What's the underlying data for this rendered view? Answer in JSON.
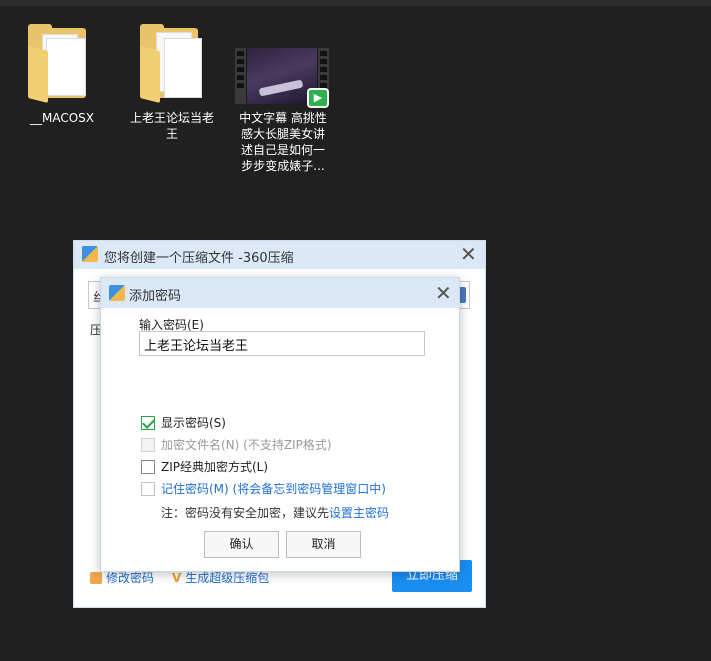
{
  "desktop": {
    "items": [
      {
        "label": "__MACOSX"
      },
      {
        "label": "上老王论坛当老王"
      },
      {
        "label": "中文字幕 高挑性感大长腿美女讲述自己是如何一步步变成婊子..."
      }
    ]
  },
  "outer_dialog": {
    "title": "您将创建一个压缩文件 -360压缩",
    "input_stub": "丝",
    "label_stub": "压",
    "modify_password_link": "修改密码",
    "super_package_link": "生成超级压缩包",
    "compress_button": "立即压缩"
  },
  "password_dialog": {
    "title": "添加密码",
    "password_label": "输入密码(E)",
    "password_value": "上老王论坛当老王",
    "options": {
      "show_password": "显示密码(S)",
      "encrypt_filename": "加密文件名(N) (不支持ZIP格式)",
      "zip_classic": "ZIP经典加密方式(L)",
      "remember_password": "记住密码(M) (将会备忘到密码管理窗口中)"
    },
    "note_text": "注：密码没有安全加密，建议先",
    "note_link": "设置主密码",
    "ok_button": "确认",
    "cancel_button": "取消"
  },
  "colors": {
    "desktop_bg": "#202020",
    "titlebar": "#dbe8f7",
    "accent": "#1b8ef2",
    "check_green": "#2aa34b",
    "link_blue": "#1f6fd1"
  },
  "icons": [
    "folder-icon",
    "video-file-icon",
    "app-icon",
    "close-icon",
    "lock-icon",
    "checkbox-checked-icon"
  ]
}
